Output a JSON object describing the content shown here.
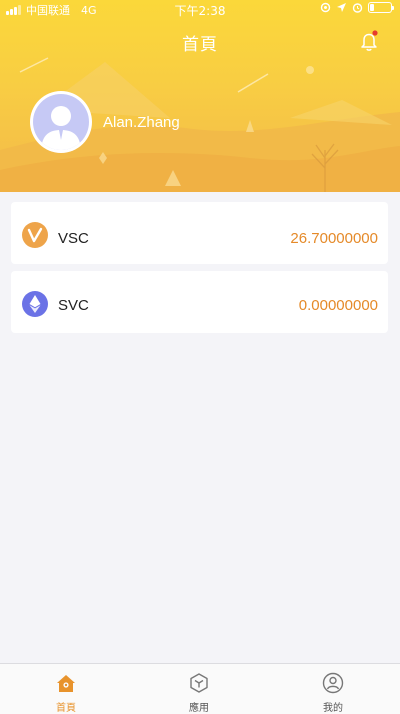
{
  "status_bar": {
    "carrier": "中国联通",
    "network": "4G",
    "time": "下午2:38"
  },
  "header": {
    "title": "首頁",
    "notification_icon": "bell-icon",
    "has_unread": true
  },
  "profile": {
    "username": "Alan.Zhang",
    "avatar_icon": "user-avatar-icon"
  },
  "assets": [
    {
      "name": "VSC",
      "amount": "26.70000000",
      "icon": "vsc-coin-icon",
      "color": "#eea44a"
    },
    {
      "name": "SVC",
      "amount": "0.00000000",
      "icon": "ethereum-icon",
      "color": "#6b72e6"
    }
  ],
  "tabbar": {
    "tabs": [
      {
        "label": "首頁",
        "icon": "home-icon",
        "active": true
      },
      {
        "label": "應用",
        "icon": "cube-icon",
        "active": false
      },
      {
        "label": "我的",
        "icon": "profile-icon",
        "active": false
      }
    ]
  },
  "colors": {
    "accent": "#e8932c",
    "amount": "#e58a29",
    "hero_top": "#fbd83a",
    "hero_bottom": "#f3b94a",
    "page_bg": "#f4f4f8"
  }
}
